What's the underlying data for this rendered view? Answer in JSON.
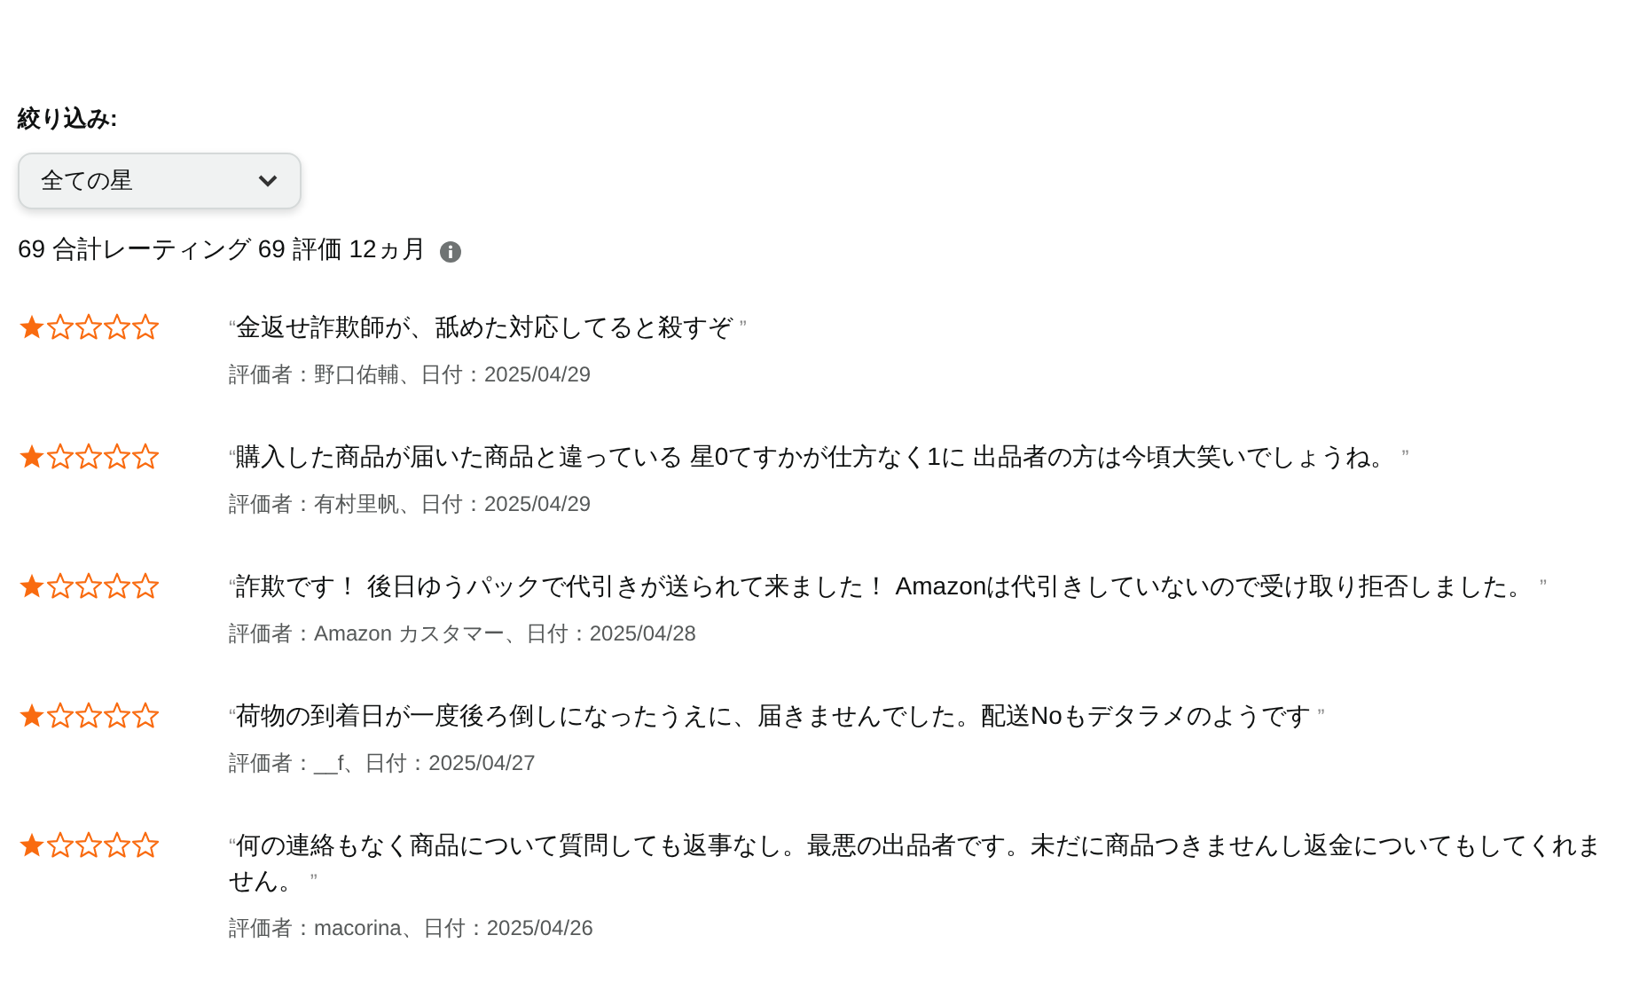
{
  "filter": {
    "label": "絞り込み:",
    "select": {
      "value": "全ての星"
    }
  },
  "summary": "69 合計レーティング 69 評価 12ヵ月",
  "reviews": [
    {
      "stars": 1,
      "open_quote": "“",
      "text": "金返せ詐欺師が、舐めた対応してると殺すぞ",
      "close_quote": "”",
      "meta": "評価者：野口佑輔、日付：2025/04/29"
    },
    {
      "stars": 1,
      "open_quote": "“",
      "text": "購入した商品が届いた商品と違っている 星0てすかが仕方なく1に 出品者の方は今頃大笑いでしょうね。",
      "close_quote": "”",
      "meta": "評価者：有村里帆、日付：2025/04/29"
    },
    {
      "stars": 1,
      "open_quote": "“",
      "text": "詐欺です！ 後日ゆうパックで代引きが送られて来ました！ Amazonは代引きしていないので受け取り拒否しました。",
      "close_quote": "”",
      "meta": "評価者：Amazon カスタマー、日付：2025/04/28"
    },
    {
      "stars": 1,
      "open_quote": "“",
      "text": "荷物の到着日が一度後ろ倒しになったうえに、届きませんでした。配送Noもデタラメのようです",
      "close_quote": "”",
      "meta": "評価者：__f、日付：2025/04/27"
    },
    {
      "stars": 1,
      "open_quote": "“",
      "text": "何の連絡もなく商品について質問しても返事なし。最悪の出品者です。未だに商品つきませんし返金についてもしてくれません。",
      "close_quote": "”",
      "meta": "評価者：macorina、日付：2025/04/26"
    }
  ]
}
